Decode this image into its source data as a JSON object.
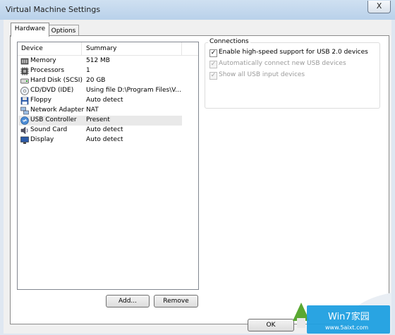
{
  "window": {
    "title": "Virtual Machine Settings",
    "close_glyph": "X"
  },
  "tabs": [
    {
      "label": "Hardware"
    },
    {
      "label": "Options"
    }
  ],
  "device_list": {
    "columns": [
      "Device",
      "Summary"
    ],
    "rows": [
      {
        "name": "Memory",
        "summary": "512 MB",
        "icon": "memory-icon"
      },
      {
        "name": "Processors",
        "summary": "1",
        "icon": "processor-icon"
      },
      {
        "name": "Hard Disk (SCSI)",
        "summary": "20 GB",
        "icon": "hard-disk-icon"
      },
      {
        "name": "CD/DVD (IDE)",
        "summary": "Using file D:\\Program Files\\V...",
        "icon": "cd-dvd-icon"
      },
      {
        "name": "Floppy",
        "summary": "Auto detect",
        "icon": "floppy-icon"
      },
      {
        "name": "Network Adapter",
        "summary": "NAT",
        "icon": "network-adapter-icon"
      },
      {
        "name": "USB Controller",
        "summary": "Present",
        "icon": "usb-icon",
        "selected": true
      },
      {
        "name": "Sound Card",
        "summary": "Auto detect",
        "icon": "sound-card-icon"
      },
      {
        "name": "Display",
        "summary": "Auto detect",
        "icon": "display-icon"
      }
    ]
  },
  "buttons": {
    "add": "Add...",
    "remove": "Remove",
    "ok": "OK"
  },
  "connections": {
    "title": "Connections",
    "options": [
      {
        "label": "Enable high-speed support for USB 2.0 devices",
        "checked": true,
        "enabled": true
      },
      {
        "label": "Automatically connect new USB devices",
        "checked": true,
        "enabled": false
      },
      {
        "label": "Show all USB input devices",
        "checked": true,
        "enabled": false
      }
    ]
  },
  "watermark": {
    "brand": "Win7家园",
    "url": "www.5aixt.com"
  }
}
